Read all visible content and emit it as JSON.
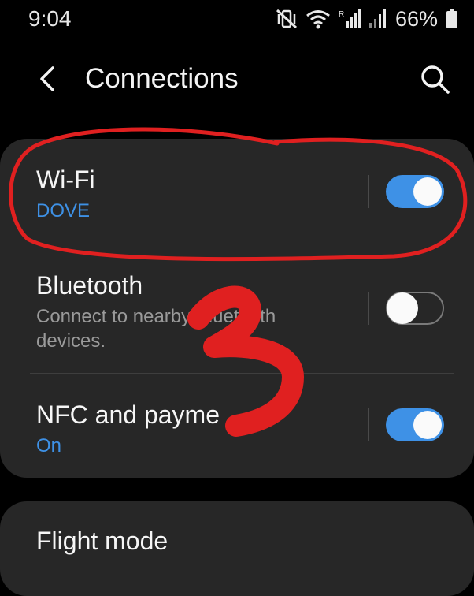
{
  "status_bar": {
    "time": "9:04",
    "battery_percent": "66%",
    "icons": [
      "vibrate-mute-icon",
      "wifi-icon",
      "signal-icon",
      "signal-icon",
      "battery-icon"
    ]
  },
  "header": {
    "title": "Connections",
    "back_icon": "chevron-left-icon",
    "search_icon": "search-icon"
  },
  "settings": [
    {
      "title": "Wi-Fi",
      "subtitle": "DOVE",
      "enabled": true
    },
    {
      "title": "Bluetooth",
      "subtitle_line1": "Connect to nearby Bluetooth",
      "subtitle_line2": "devices.",
      "enabled": false
    },
    {
      "title": "NFC and payme",
      "subtitle": "On",
      "enabled": true
    }
  ],
  "next_card": {
    "title": "Flight mode"
  },
  "colors": {
    "background": "#000000",
    "card": "#272727",
    "accent": "#3e91e6",
    "annotation": "#e02020"
  }
}
